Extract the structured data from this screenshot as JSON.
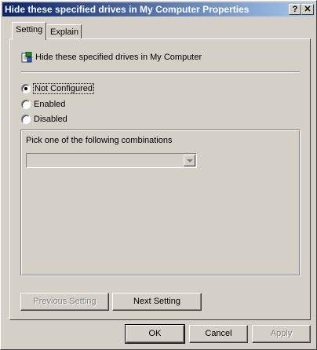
{
  "window": {
    "title": "Hide these specified drives in My Computer Properties",
    "help_label": "?",
    "close_label": "✕"
  },
  "tabs": [
    {
      "label": "Setting"
    },
    {
      "label": "Explain"
    }
  ],
  "setting": {
    "heading": "Hide these specified drives in My Computer",
    "options": [
      {
        "label": "Not Configured",
        "checked": true
      },
      {
        "label": "Enabled",
        "checked": false
      },
      {
        "label": "Disabled",
        "checked": false
      }
    ],
    "pick_label": "Pick one of the following combinations",
    "combo_value": ""
  },
  "nav_buttons": {
    "previous": "Previous Setting",
    "next": "Next Setting"
  },
  "dialog_buttons": {
    "ok": "OK",
    "cancel": "Cancel",
    "apply": "Apply"
  }
}
